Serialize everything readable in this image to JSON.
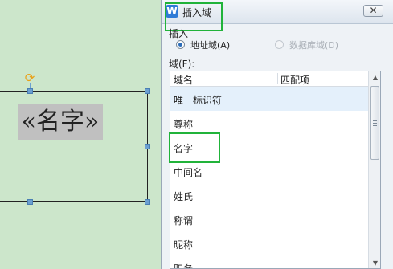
{
  "document": {
    "merge_field_text": "«名字»"
  },
  "dialog": {
    "title": "插入域",
    "app_logo_letter": "W",
    "close_symbol": "✕",
    "insert_label": "插入",
    "radio_address": "地址域(A)",
    "radio_database": "数据库域(D)",
    "fields_label": "域(F):",
    "columns": [
      "域名",
      "匹配项"
    ],
    "fields": [
      "唯一标识符",
      "尊称",
      "名字",
      "中间名",
      "姓氏",
      "称谓",
      "昵称",
      "职务"
    ],
    "selected_field_index": 0,
    "highlighted_field": "名字"
  },
  "colors": {
    "highlight": "#21b33a",
    "selection_handle": "#6b9fd1",
    "rotate_handle": "#e8a21b",
    "doc_background": "#cce6cb"
  },
  "icons": [
    "rotate-icon",
    "app-logo-icon",
    "close-icon",
    "scroll-up-icon",
    "scroll-down-icon",
    "scroll-grip-icon"
  ]
}
